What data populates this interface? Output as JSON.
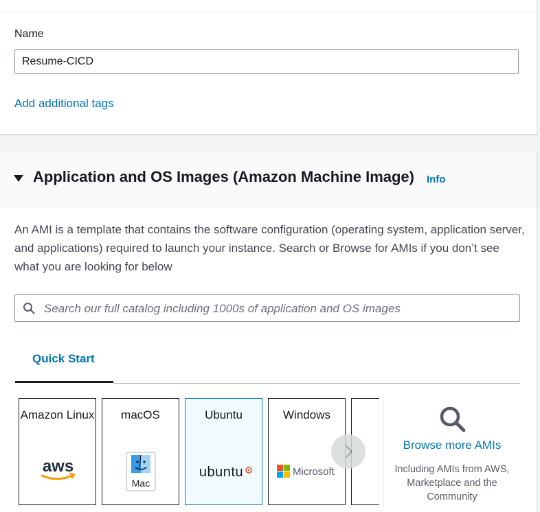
{
  "tags_section": {
    "name_label": "Name",
    "name_value": "Resume-CICD",
    "add_tags_link": "Add additional tags"
  },
  "ami_section": {
    "title": "Application and OS Images (Amazon Machine Image)",
    "info_link": "Info",
    "description": "An AMI is a template that contains the software configuration (operating system, application server, and applications) required to launch your instance. Search or Browse for AMIs if you don’t see what you are looking for below",
    "search_placeholder": "Search our full catalog including 1000s of application and OS images",
    "tabs": [
      {
        "label": "Quick Start",
        "selected": true
      }
    ],
    "os_cards": [
      {
        "label": "Amazon Linux",
        "logo_text": "aws",
        "icon": "aws-logo",
        "selected": false
      },
      {
        "label": "macOS",
        "logo_text": "Mac",
        "icon": "mac-finder-logo",
        "selected": false
      },
      {
        "label": "Ubuntu",
        "logo_text": "ubuntu",
        "icon": "ubuntu-logo",
        "selected": true
      },
      {
        "label": "Windows",
        "logo_text": "Microsoft",
        "icon": "microsoft-logo",
        "selected": false
      }
    ],
    "browse_more": {
      "link": "Browse more AMIs",
      "description": "Including AMIs from AWS, Marketplace and the Community"
    }
  },
  "colors": {
    "link": "#0073bb",
    "selected_card_bg": "#f1faff",
    "ubuntu_orange": "#e95420",
    "aws_orange": "#ff9900"
  }
}
